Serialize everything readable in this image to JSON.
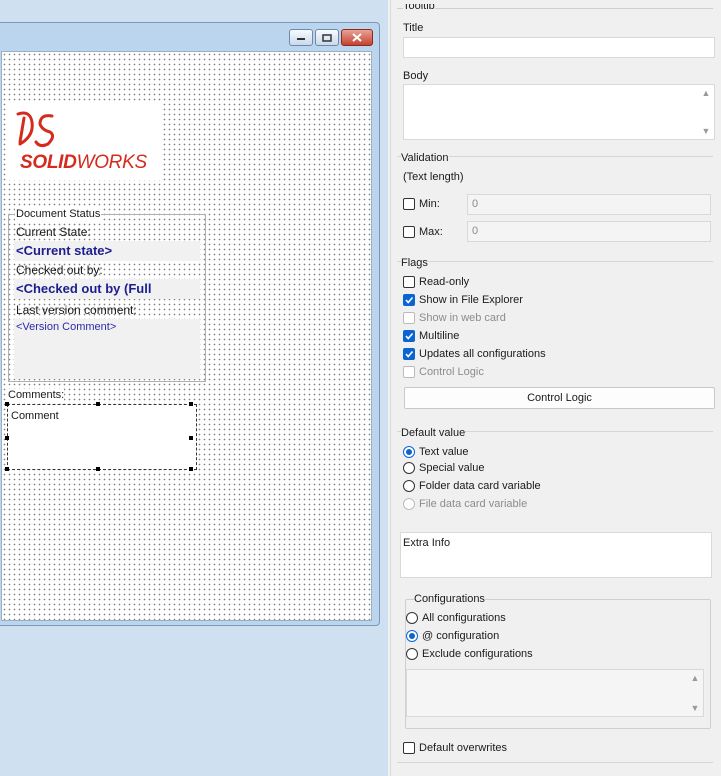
{
  "card_editor": {
    "logo": {
      "brand_text_bold": "SOLID",
      "brand_text": "WORKS"
    },
    "document_status": {
      "caption": "Document Status",
      "current_state_label": "Current State:",
      "current_state_var": "<Current state>",
      "checked_out_label": "Checked out by:",
      "checked_out_var": "<Checked out by (Full",
      "last_comment_label": "Last version comment:",
      "version_comment_var": "<Version Comment>"
    },
    "comments_label": "Comments:",
    "comment_field_text": "Comment"
  },
  "properties": {
    "tooltip_section_caption": "Tooltip",
    "title_label": "Title",
    "title_value": "",
    "body_label": "Body",
    "body_value": "",
    "validation": {
      "caption": "Validation",
      "subcaption": "(Text length)",
      "min_label": "Min:",
      "min_value": "0",
      "max_label": "Max:",
      "max_value": "0"
    },
    "flags": {
      "caption": "Flags",
      "items": [
        {
          "label": "Read-only",
          "checked": false,
          "disabled": false
        },
        {
          "label": "Show in File Explorer",
          "checked": true,
          "disabled": false
        },
        {
          "label": "Show in web card",
          "checked": false,
          "disabled": true
        },
        {
          "label": "Multiline",
          "checked": true,
          "disabled": false
        },
        {
          "label": "Updates all configurations",
          "checked": true,
          "disabled": false
        },
        {
          "label": "Control Logic",
          "checked": false,
          "disabled": true
        }
      ],
      "control_logic_button": "Control Logic"
    },
    "default_value": {
      "caption": "Default value",
      "options": [
        {
          "label": "Text value",
          "selected": true,
          "disabled": false
        },
        {
          "label": "Special value",
          "selected": false,
          "disabled": false
        },
        {
          "label": "Folder data card variable",
          "selected": false,
          "disabled": false
        },
        {
          "label": "File data card variable",
          "selected": false,
          "disabled": true
        }
      ]
    },
    "extra_info_label": "Extra Info",
    "configurations": {
      "caption": "Configurations",
      "options": [
        {
          "label": "All configurations",
          "selected": false
        },
        {
          "label": "@ configuration",
          "selected": true
        },
        {
          "label": "Exclude configurations",
          "selected": false
        }
      ]
    },
    "default_overwrites_label": "Default overwrites"
  },
  "colors": {
    "accent": "#0a64d2",
    "brand_red": "#d52b1e"
  }
}
